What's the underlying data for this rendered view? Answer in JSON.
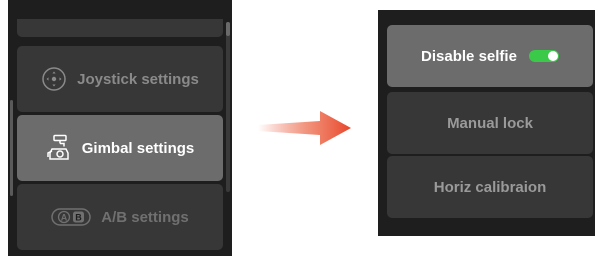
{
  "left_menu": {
    "items": [
      {
        "label": "Joystick settings",
        "icon": "joystick-icon",
        "selected": false
      },
      {
        "label": "Gimbal settings",
        "icon": "gimbal-icon",
        "selected": true
      },
      {
        "label": "A/B settings",
        "icon": "ab-button-icon",
        "selected": false
      }
    ]
  },
  "right_menu": {
    "items": [
      {
        "label": "Disable selfie",
        "selected": true,
        "toggle_on": true
      },
      {
        "label": "Manual lock",
        "selected": false
      },
      {
        "label": "Horiz calibraion",
        "selected": false
      }
    ]
  },
  "ab_icon": {
    "a_letter": "A",
    "b_letter": "B"
  },
  "colors": {
    "panel_bg": "#1e1e1e",
    "item_bg": "#373737",
    "selected_bg": "#6c6c6c",
    "toggle_on": "#3bc94a",
    "arrow": "#e8462a"
  }
}
